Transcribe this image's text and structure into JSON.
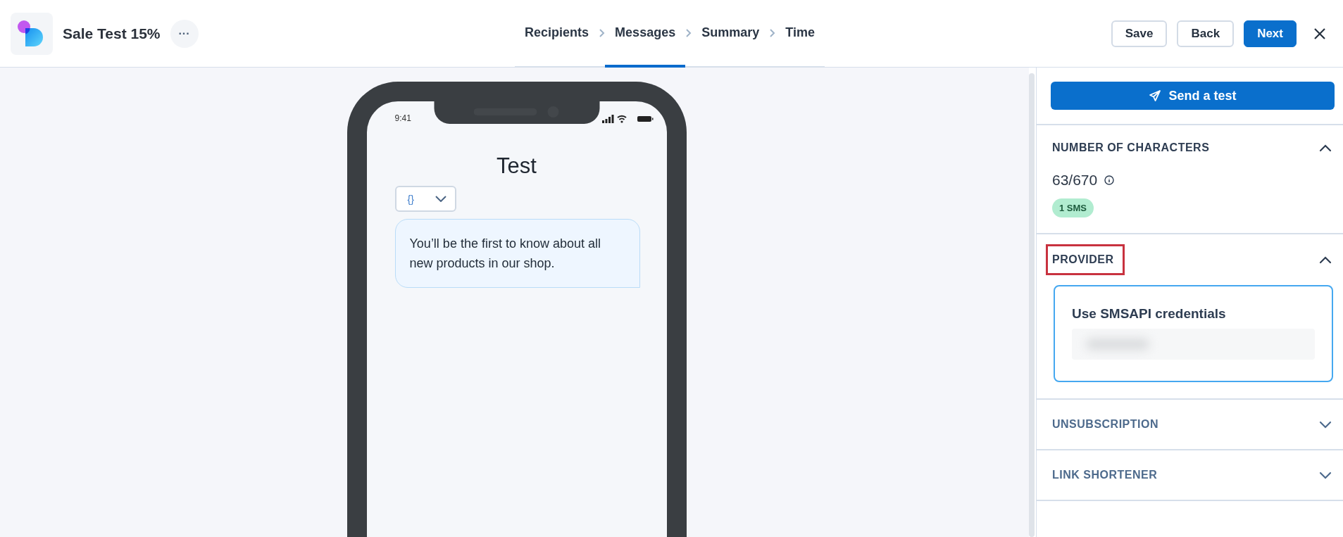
{
  "header": {
    "title": "Sale Test 15%",
    "more_button": "···",
    "steps": [
      {
        "label": "Recipients",
        "selected": false
      },
      {
        "label": "Messages",
        "selected": true
      },
      {
        "label": "Summary",
        "selected": false
      },
      {
        "label": "Time",
        "selected": false
      }
    ],
    "buttons": [
      {
        "label": "Save",
        "kind": "outline"
      },
      {
        "label": "Back",
        "kind": "outline"
      },
      {
        "label": "Next",
        "kind": "primary"
      }
    ]
  },
  "phone": {
    "time": "9:41",
    "title": "Test",
    "variable_button": "{}",
    "message": "You’ll be the first to know about all new products in our shop."
  },
  "panel": {
    "send_test": "Send a test",
    "sections": [
      {
        "kind": "characters",
        "title": "NUMBER OF CHARACTERS",
        "expanded": true,
        "highlighted": false,
        "count": "63/670",
        "badge": "1 SMS"
      },
      {
        "kind": "provider",
        "title": "PROVIDER",
        "expanded": true,
        "highlighted": true,
        "card_title": "Use SMSAPI credentials"
      },
      {
        "kind": "plain",
        "title": "UNSUBSCRIPTION",
        "expanded": false,
        "highlighted": false
      },
      {
        "kind": "plain",
        "title": "LINK SHORTENER",
        "expanded": false,
        "highlighted": false
      }
    ]
  }
}
